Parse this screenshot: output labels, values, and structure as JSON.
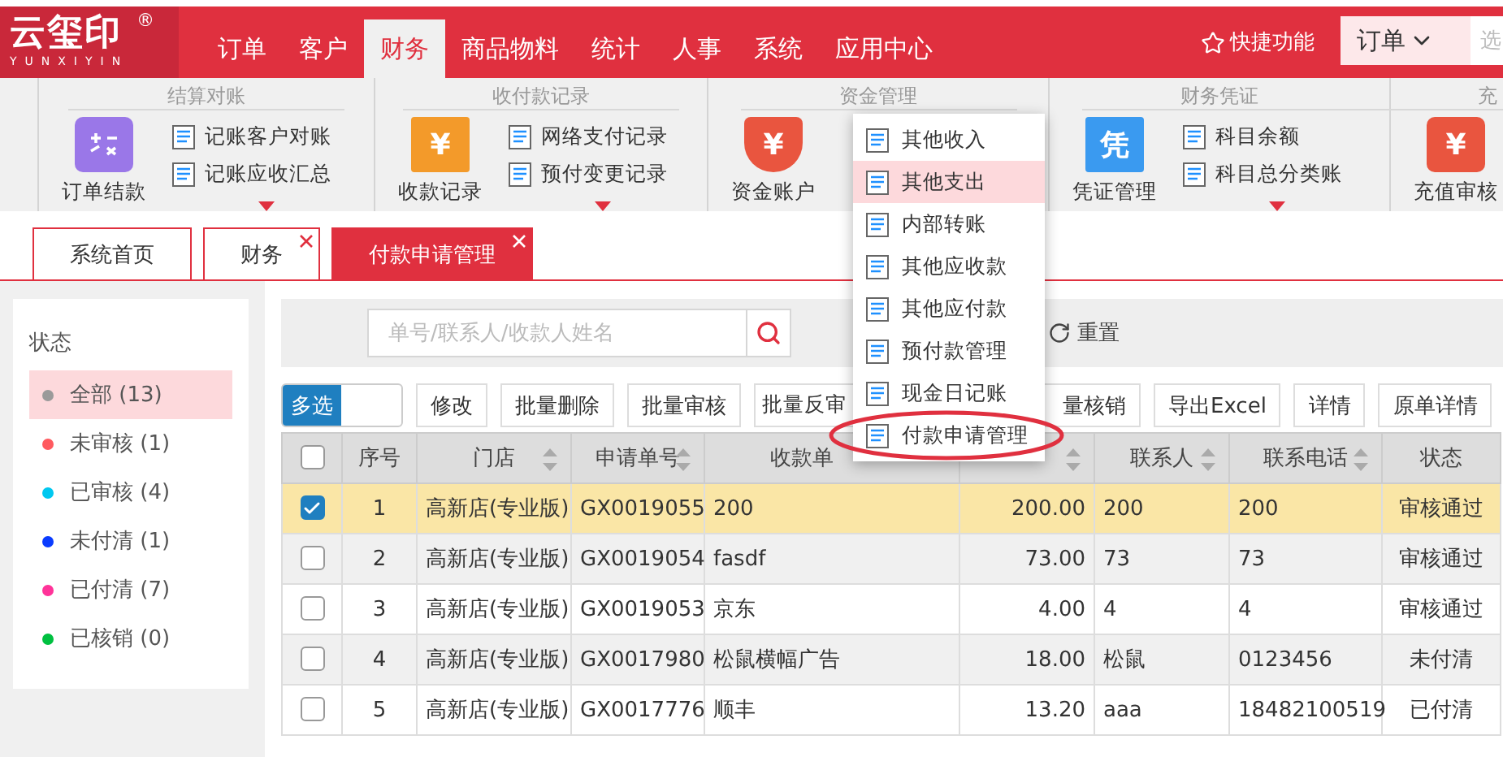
{
  "logo": {
    "text": "云玺印",
    "sub": "YUNXIYIN",
    "mark": "®"
  },
  "nav": {
    "items": [
      {
        "label": "订单",
        "selected": false
      },
      {
        "label": "客户",
        "selected": false
      },
      {
        "label": "财务",
        "selected": true
      },
      {
        "label": "商品物料",
        "selected": false
      },
      {
        "label": "统计",
        "selected": false
      },
      {
        "label": "人事",
        "selected": false
      },
      {
        "label": "系统",
        "selected": false
      },
      {
        "label": "应用中心",
        "selected": false
      }
    ],
    "quick": "快捷功能",
    "scope": "订单",
    "search_placeholder": "选"
  },
  "ribbon": {
    "groups": [
      {
        "title": "结算对账",
        "big": {
          "label": "订单结款"
        },
        "items": [
          "记账客户对账",
          "记账应收汇总"
        ],
        "more": true
      },
      {
        "title": "收付款记录",
        "big": {
          "label": "收款记录",
          "glyph": "¥"
        },
        "items": [
          "网络支付记录",
          "预付变更记录"
        ],
        "more": true
      },
      {
        "title": "资金管理",
        "big": {
          "label": "资金账户",
          "glyph": "¥"
        },
        "menu": [
          {
            "label": "其他收入",
            "selected": false,
            "circled": false
          },
          {
            "label": "其他支出",
            "selected": true,
            "circled": false
          },
          {
            "label": "内部转账",
            "selected": false,
            "circled": false
          },
          {
            "label": "其他应收款",
            "selected": false,
            "circled": false
          },
          {
            "label": "其他应付款",
            "selected": false,
            "circled": false
          },
          {
            "label": "预付款管理",
            "selected": false,
            "circled": false
          },
          {
            "label": "现金日记账",
            "selected": false,
            "circled": false
          },
          {
            "label": "付款申请管理",
            "selected": false,
            "circled": true
          }
        ]
      },
      {
        "title": "财务凭证",
        "big": {
          "label": "凭证管理",
          "glyph": "凭"
        },
        "items": [
          "科目余额",
          "科目总分类账"
        ],
        "more": true
      },
      {
        "title": "充",
        "big": {
          "label": "充值审核",
          "glyph": "¥"
        }
      }
    ]
  },
  "tabs": [
    {
      "label": "系统首页",
      "selected": false,
      "closable": false
    },
    {
      "label": "财务",
      "selected": false,
      "closable": true
    },
    {
      "label": "付款申请管理",
      "selected": true,
      "closable": true
    }
  ],
  "sidebar": {
    "title": "状态",
    "items": [
      {
        "label": "全部 (13)",
        "color": "#9a9a9a",
        "selected": true
      },
      {
        "label": "未审核 (1)",
        "color": "#ff5a5f",
        "selected": false
      },
      {
        "label": "已审核 (4)",
        "color": "#00c8f0",
        "selected": false
      },
      {
        "label": "未付清 (1)",
        "color": "#0a3cff",
        "selected": false
      },
      {
        "label": "已付清 (7)",
        "color": "#ff3399",
        "selected": false
      },
      {
        "label": "已核销 (0)",
        "color": "#00c040",
        "selected": false
      }
    ]
  },
  "search": {
    "placeholder": "单号/联系人/收款人姓名",
    "reset": "重置"
  },
  "multi": {
    "label": "多选",
    "on": true
  },
  "buttons": [
    "修改",
    "批量删除",
    "批量审核",
    "批量反审",
    "量核销",
    "导出Excel",
    "详情",
    "原单详情"
  ],
  "table": {
    "select_all": {
      "checked": false
    },
    "columns": [
      {
        "label": "序号",
        "sortable": false
      },
      {
        "label": "门店",
        "sortable": true
      },
      {
        "label": "申请单号",
        "sortable": true
      },
      {
        "label": "收款单",
        "sortable": false
      },
      {
        "sortable": true
      },
      {
        "label": "联系人",
        "sortable": true
      },
      {
        "label": "联系电话",
        "sortable": true
      },
      {
        "label": "状态",
        "sortable": false
      }
    ],
    "rows": [
      {
        "checked": true,
        "selected": true,
        "cells": [
          "1",
          "高新店(专业版)",
          "GX0019055",
          "200",
          "200.00",
          "200",
          "200",
          "审核通过"
        ]
      },
      {
        "checked": false,
        "selected": false,
        "cells": [
          "2",
          "高新店(专业版)",
          "GX0019054",
          "fasdf",
          "73.00",
          "73",
          "73",
          "审核通过"
        ]
      },
      {
        "checked": false,
        "selected": false,
        "cells": [
          "3",
          "高新店(专业版)",
          "GX0019053",
          "京东",
          "4.00",
          "4",
          "4",
          "审核通过"
        ]
      },
      {
        "checked": false,
        "selected": false,
        "cells": [
          "4",
          "高新店(专业版)",
          "GX0017980",
          "松鼠横幅广告",
          "18.00",
          "松鼠",
          "0123456",
          "未付清"
        ]
      },
      {
        "checked": false,
        "selected": false,
        "cells": [
          "5",
          "高新店(专业版)",
          "GX0017776",
          "顺丰",
          "13.20",
          "aaa",
          "18482100519",
          "已付清"
        ]
      }
    ]
  }
}
